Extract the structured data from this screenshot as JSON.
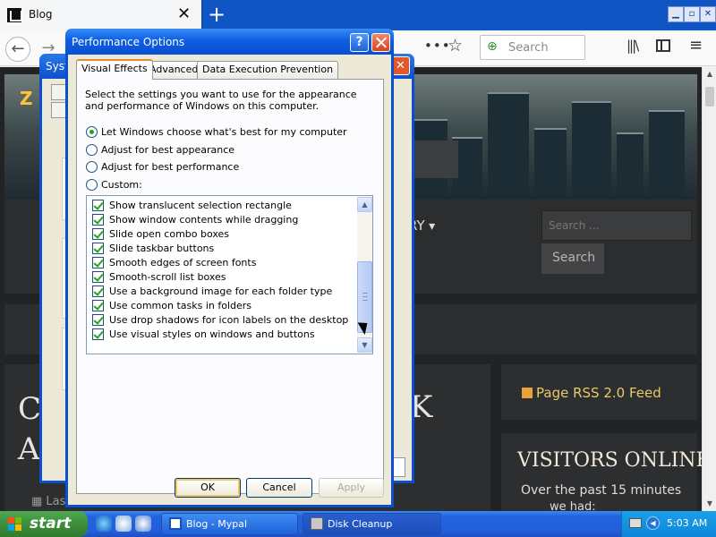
{
  "browser": {
    "tab_title": "Blog",
    "tab_close": "✕",
    "new_tab": "+",
    "window_buttons": [
      "▁",
      "▫",
      "✕"
    ],
    "back_glyph": "←",
    "forward_glyph": "→",
    "page_actions": "•••",
    "bookmark_glyph": "☆",
    "search_placeholder": "Search",
    "library_glyph": "|||\\",
    "menu_glyph": "≡"
  },
  "webpage": {
    "logo_fragment": "Z",
    "nav_fragment": "RY",
    "search_placeholder": "Search ...",
    "search_button": "Search",
    "heading_fragment_1": "C",
    "heading_fragment_2": "A",
    "heading_fragment_3": "K",
    "date_fragment": "Las",
    "rss_feed": "Page RSS 2.0 Feed",
    "visitors_title": "VISITORS ONLINE",
    "visitors_subtitle": "Over the past 15 minutes",
    "visitors_line3": "we had:"
  },
  "system_properties": {
    "title_fragment": "Syst",
    "close_glyph": "✕"
  },
  "dialog": {
    "title": "Performance Options",
    "help_glyph": "?",
    "tabs": [
      "Visual Effects",
      "Advanced",
      "Data Execution Prevention"
    ],
    "active_tab": "Visual Effects",
    "intro": "Select the settings you want to use for the appearance and performance of Windows on this computer.",
    "radio_options": [
      {
        "label": "Let Windows choose what's best for my computer",
        "selected": true
      },
      {
        "label": "Adjust for best appearance",
        "selected": false
      },
      {
        "label": "Adjust for best performance",
        "selected": false
      },
      {
        "label": "Custom:",
        "selected": false
      }
    ],
    "effects": [
      {
        "label": "Show translucent selection rectangle",
        "checked": true
      },
      {
        "label": "Show window contents while dragging",
        "checked": true
      },
      {
        "label": "Slide open combo boxes",
        "checked": true
      },
      {
        "label": "Slide taskbar buttons",
        "checked": true
      },
      {
        "label": "Smooth edges of screen fonts",
        "checked": true
      },
      {
        "label": "Smooth-scroll list boxes",
        "checked": true
      },
      {
        "label": "Use a background image for each folder type",
        "checked": true
      },
      {
        "label": "Use common tasks in folders",
        "checked": true
      },
      {
        "label": "Use drop shadows for icon labels on the desktop",
        "checked": true
      },
      {
        "label": "Use visual styles on windows and buttons",
        "checked": true
      }
    ],
    "scroll_up": "▲",
    "scroll_down": "▼",
    "buttons": {
      "ok": "OK",
      "cancel": "Cancel",
      "apply": "Apply"
    },
    "apply_enabled": false
  },
  "taskbar": {
    "start_label": "start",
    "tasks": [
      {
        "label": "Blog - Mypal",
        "active": false
      },
      {
        "label": "Disk Cleanup",
        "active": true
      }
    ],
    "tray_arrow": "◀",
    "clock": "5:03 AM"
  },
  "colors": {
    "xp_blue": "#0a4fd0",
    "start_green": "#3c8e3c",
    "check_green": "#21a121",
    "dialog_bg": "#ece9d8"
  }
}
